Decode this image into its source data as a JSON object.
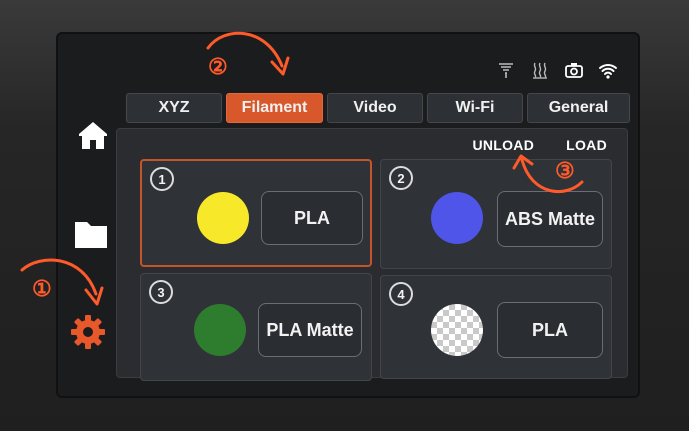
{
  "tabs": [
    {
      "label": "XYZ"
    },
    {
      "label": "Filament"
    },
    {
      "label": "Video"
    },
    {
      "label": "Wi-Fi"
    },
    {
      "label": "General"
    }
  ],
  "actions": {
    "unload": "UNLOAD",
    "load": "LOAD"
  },
  "slots": [
    {
      "number": "1",
      "material": "PLA",
      "color": "#f7e92a"
    },
    {
      "number": "2",
      "material": "ABS Matte",
      "color": "#4e55e8"
    },
    {
      "number": "3",
      "material": "PLA Matte",
      "color": "#2e7d2e"
    },
    {
      "number": "4",
      "material": "PLA",
      "color": "transparent"
    }
  ],
  "annotations": {
    "step1": "①",
    "step2": "②",
    "step3": "③"
  },
  "colors": {
    "accent": "#d9582b",
    "annotation": "#ff5a2a"
  }
}
